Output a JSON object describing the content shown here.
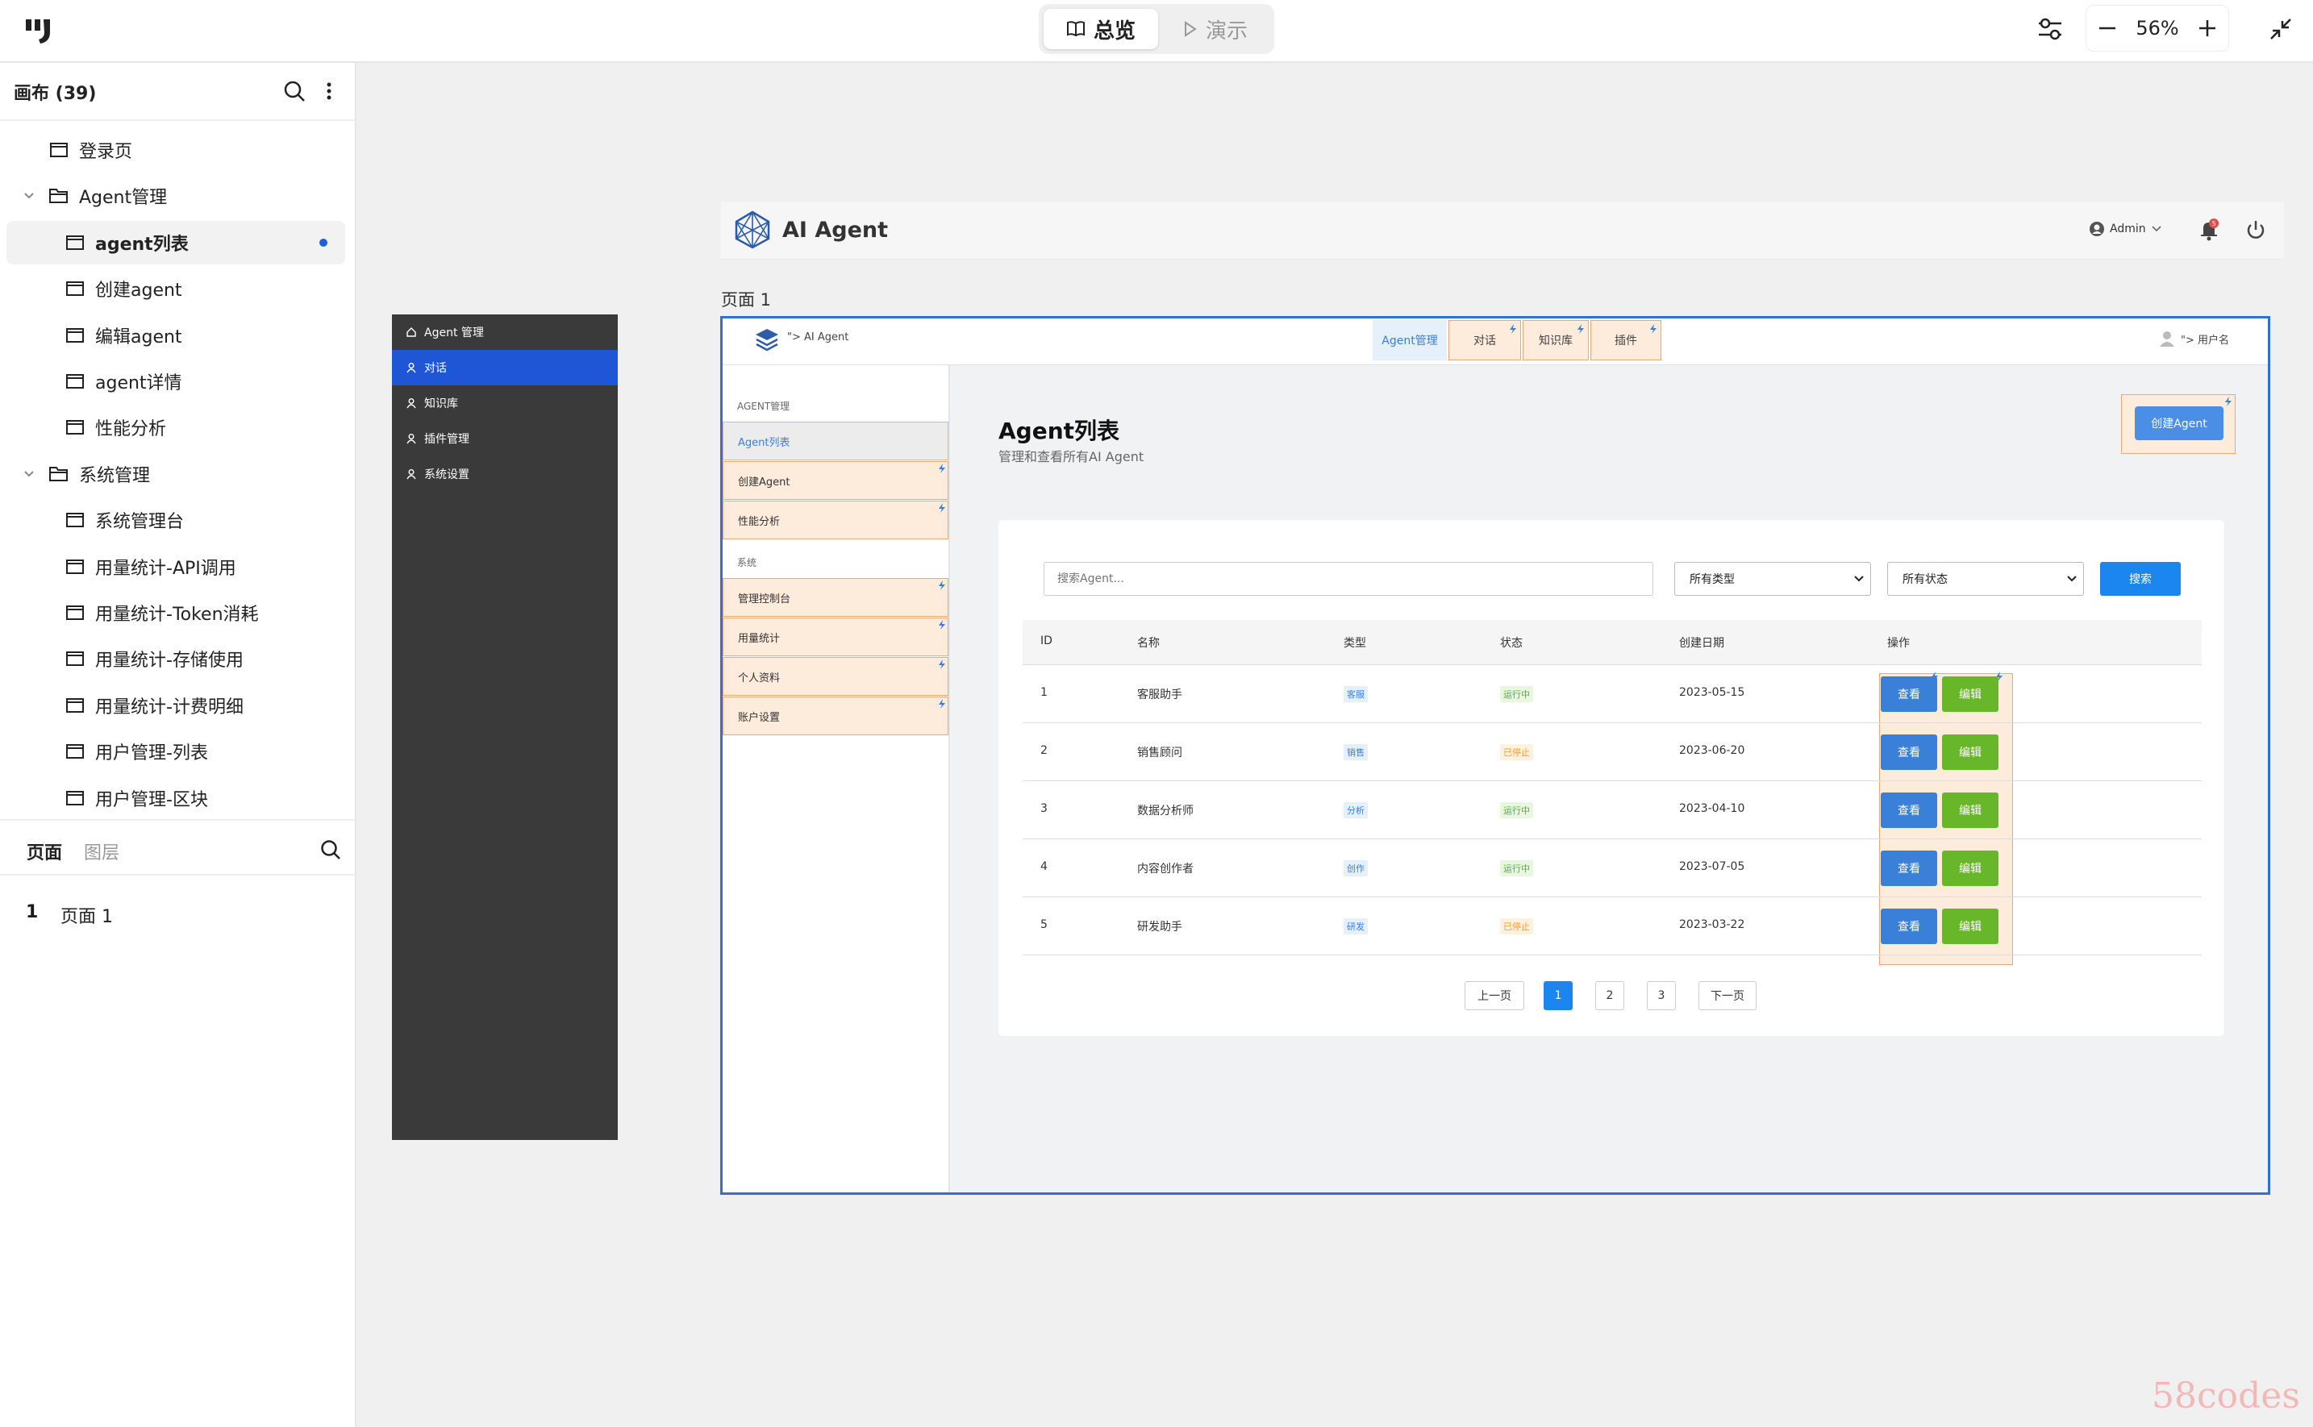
{
  "topbar": {
    "mode_overview": "总览",
    "mode_present": "演示",
    "zoom": "56%"
  },
  "left_panel": {
    "title": "画布 (39)",
    "tree": [
      {
        "label": "登录页",
        "level": 0,
        "type": "page"
      },
      {
        "label": "Agent管理",
        "level": 0,
        "type": "folder"
      },
      {
        "label": "agent列表",
        "level": 1,
        "type": "page",
        "selected": true
      },
      {
        "label": "创建agent",
        "level": 1,
        "type": "page"
      },
      {
        "label": "编辑agent",
        "level": 1,
        "type": "page"
      },
      {
        "label": "agent详情",
        "level": 1,
        "type": "page"
      },
      {
        "label": "性能分析",
        "level": 1,
        "type": "page"
      },
      {
        "label": "系统管理",
        "level": 0,
        "type": "folder"
      },
      {
        "label": "系统管理台",
        "level": 1,
        "type": "page"
      },
      {
        "label": "用量统计-API调用",
        "level": 1,
        "type": "page"
      },
      {
        "label": "用量统计-Token消耗",
        "level": 1,
        "type": "page"
      },
      {
        "label": "用量统计-存储使用",
        "level": 1,
        "type": "page"
      },
      {
        "label": "用量统计-计费明细",
        "level": 1,
        "type": "page"
      },
      {
        "label": "用户管理-列表",
        "level": 1,
        "type": "page"
      },
      {
        "label": "用户管理-区块",
        "level": 1,
        "type": "page"
      }
    ],
    "tab_pages": "页面",
    "tab_layers": "图层",
    "page_number": "1",
    "page_name": "页面 1"
  },
  "dark_menu": {
    "items": [
      {
        "label": "Agent 管理",
        "icon": "home-icon"
      },
      {
        "label": "对话",
        "icon": "user-icon",
        "active": true
      },
      {
        "label": "知识库",
        "icon": "user-icon"
      },
      {
        "label": "插件管理",
        "icon": "user-icon"
      },
      {
        "label": "系统设置",
        "icon": "user-icon"
      }
    ]
  },
  "header_card": {
    "title": "AI Agent",
    "user": "Admin",
    "badge": "5"
  },
  "page_label": "页面 1",
  "frame": {
    "brand": "\"> AI Agent",
    "nav_tabs": [
      "Agent管理",
      "对话",
      "知识库",
      "插件"
    ],
    "user": "\"> 用户名",
    "side_group1": "AGENT管理",
    "side_items1": [
      "Agent列表",
      "创建Agent",
      "性能分析"
    ],
    "side_group2": "系统",
    "side_items2": [
      "管理控制台",
      "用量统计",
      "个人资料",
      "账户设置"
    ],
    "title": "Agent列表",
    "subtitle": "管理和查看所有AI Agent",
    "create_button": "创建Agent",
    "search_placeholder": "搜索Agent...",
    "type_select": "所有类型",
    "status_select": "所有状态",
    "search_button": "搜索",
    "columns": [
      "ID",
      "名称",
      "类型",
      "状态",
      "创建日期",
      "操作"
    ],
    "rows": [
      {
        "id": "1",
        "name": "客服助手",
        "type": "客服",
        "status": "运行中",
        "date": "2023-05-15"
      },
      {
        "id": "2",
        "name": "销售顾问",
        "type": "销售",
        "status": "已停止",
        "date": "2023-06-20"
      },
      {
        "id": "3",
        "name": "数据分析师",
        "type": "分析",
        "status": "运行中",
        "date": "2023-04-10"
      },
      {
        "id": "4",
        "name": "内容创作者",
        "type": "创作",
        "status": "运行中",
        "date": "2023-07-05"
      },
      {
        "id": "5",
        "name": "研发助手",
        "type": "研发",
        "status": "已停止",
        "date": "2023-03-22"
      }
    ],
    "view_label": "查看",
    "edit_label": "编辑",
    "pagination": {
      "prev": "上一页",
      "pages": [
        "1",
        "2",
        "3"
      ],
      "next": "下一页"
    }
  },
  "watermark": "58codes",
  "colors": {
    "accent": "#2f6fd6",
    "dark_menu": "#3a3a3a",
    "menu_active": "#1e56d6",
    "annotation_fill": "#fdebdc",
    "annotation_border": "#eca873",
    "view_btn": "#3a80d8",
    "edit_btn": "#68b72b",
    "running": "#52b12c",
    "stopped": "#f0a030"
  }
}
